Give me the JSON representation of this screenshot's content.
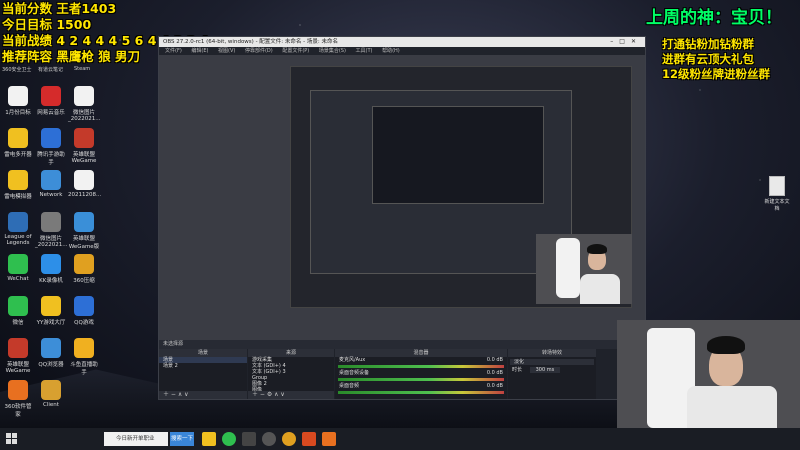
{
  "overlay": {
    "score_line": "当前分数 王者1403",
    "target_line": "今日目标 1500",
    "record_line": "当前战绩 4 2 4 4 4 5 6 4 4 3 2 4",
    "lineup_line": "推荐阵容 黑鹰枪 狼 男刀",
    "god_line": "上周的神：宝贝！",
    "group_lines": [
      "打通钻粉加钻粉群",
      "进群有云顶大礼包",
      "12级粉丝牌进粉丝群"
    ]
  },
  "desktop": {
    "top_labels": [
      "360安全卫士",
      "有道云笔记",
      "Steam"
    ],
    "icons": [
      {
        "label": "1月份目标",
        "color": "#f2f2f2"
      },
      {
        "label": "网易云音乐",
        "color": "#d52b2b"
      },
      {
        "label": "微信图片_2022021...",
        "color": "#f2f2f2"
      },
      {
        "label": "雷电多开器",
        "color": "#f0c020"
      },
      {
        "label": "腾讯手游助手",
        "color": "#2d6fd6"
      },
      {
        "label": "英雄联盟WeGame",
        "color": "#c43a2a"
      },
      {
        "label": "雷电模拟器",
        "color": "#f0c020"
      },
      {
        "label": "Network",
        "color": "#3d8ed8"
      },
      {
        "label": "20211208...",
        "color": "#f2f2f2"
      },
      {
        "label": "League of Legends",
        "color": "#2e6db5"
      },
      {
        "label": "微信图片_2022021...",
        "color": "#7a7a7a"
      },
      {
        "label": "英雄联盟WeGame版",
        "color": "#3a8fd8"
      },
      {
        "label": "WeChat",
        "color": "#2fbf4f"
      },
      {
        "label": "KK录像机",
        "color": "#2d8fe8"
      },
      {
        "label": "360压缩",
        "color": "#e0a020"
      },
      {
        "label": "微信",
        "color": "#2fbf4f"
      },
      {
        "label": "YY游戏大厅",
        "color": "#f0c020"
      },
      {
        "label": "QQ游戏",
        "color": "#2d6fd6"
      },
      {
        "label": "英雄联盟WeGame",
        "color": "#c43a2a"
      },
      {
        "label": "QQ浏览器",
        "color": "#3d8ed8"
      },
      {
        "label": "斗鱼直播助手",
        "color": "#f0b020"
      },
      {
        "label": "360软件管家",
        "color": "#e87020"
      },
      {
        "label": "Client",
        "color": "#d8a030"
      }
    ],
    "right_doc": "新建文本文档"
  },
  "obs": {
    "title": "OBS 27.2.0-rc1 (64-bit, windows) - 配置文件: 未命名 - 场景: 未命名",
    "menu": [
      "文件(F)",
      "编辑(E)",
      "视图(V)",
      "停靠部件(D)",
      "配置文件(P)",
      "场景集合(S)",
      "工具(T)",
      "帮助(H)"
    ],
    "scene_bar": "未选择源",
    "docks": {
      "scenes": "场景",
      "sources": "来源",
      "mixer": "混音器",
      "transitions": "转场特效"
    },
    "scene_items": [
      "场景",
      "场景 2"
    ],
    "source_items": [
      "游戏采集",
      "文本 (GDI+) 4",
      "文本 (GDI+) 3",
      "Group",
      "图像 2",
      "图像"
    ],
    "mixer_items": [
      {
        "name": "麦克风/Aux",
        "db": "0.0 dB"
      },
      {
        "name": "桌面音频设备",
        "db": "0.0 dB"
      },
      {
        "name": "桌面音频",
        "db": "0.0 dB"
      }
    ],
    "transition": "淡化",
    "duration_label": "时长",
    "duration_value": "300 ms"
  },
  "taskbar": {
    "search_placeholder": "今日新开单职业",
    "search_button": "搜索一下"
  }
}
